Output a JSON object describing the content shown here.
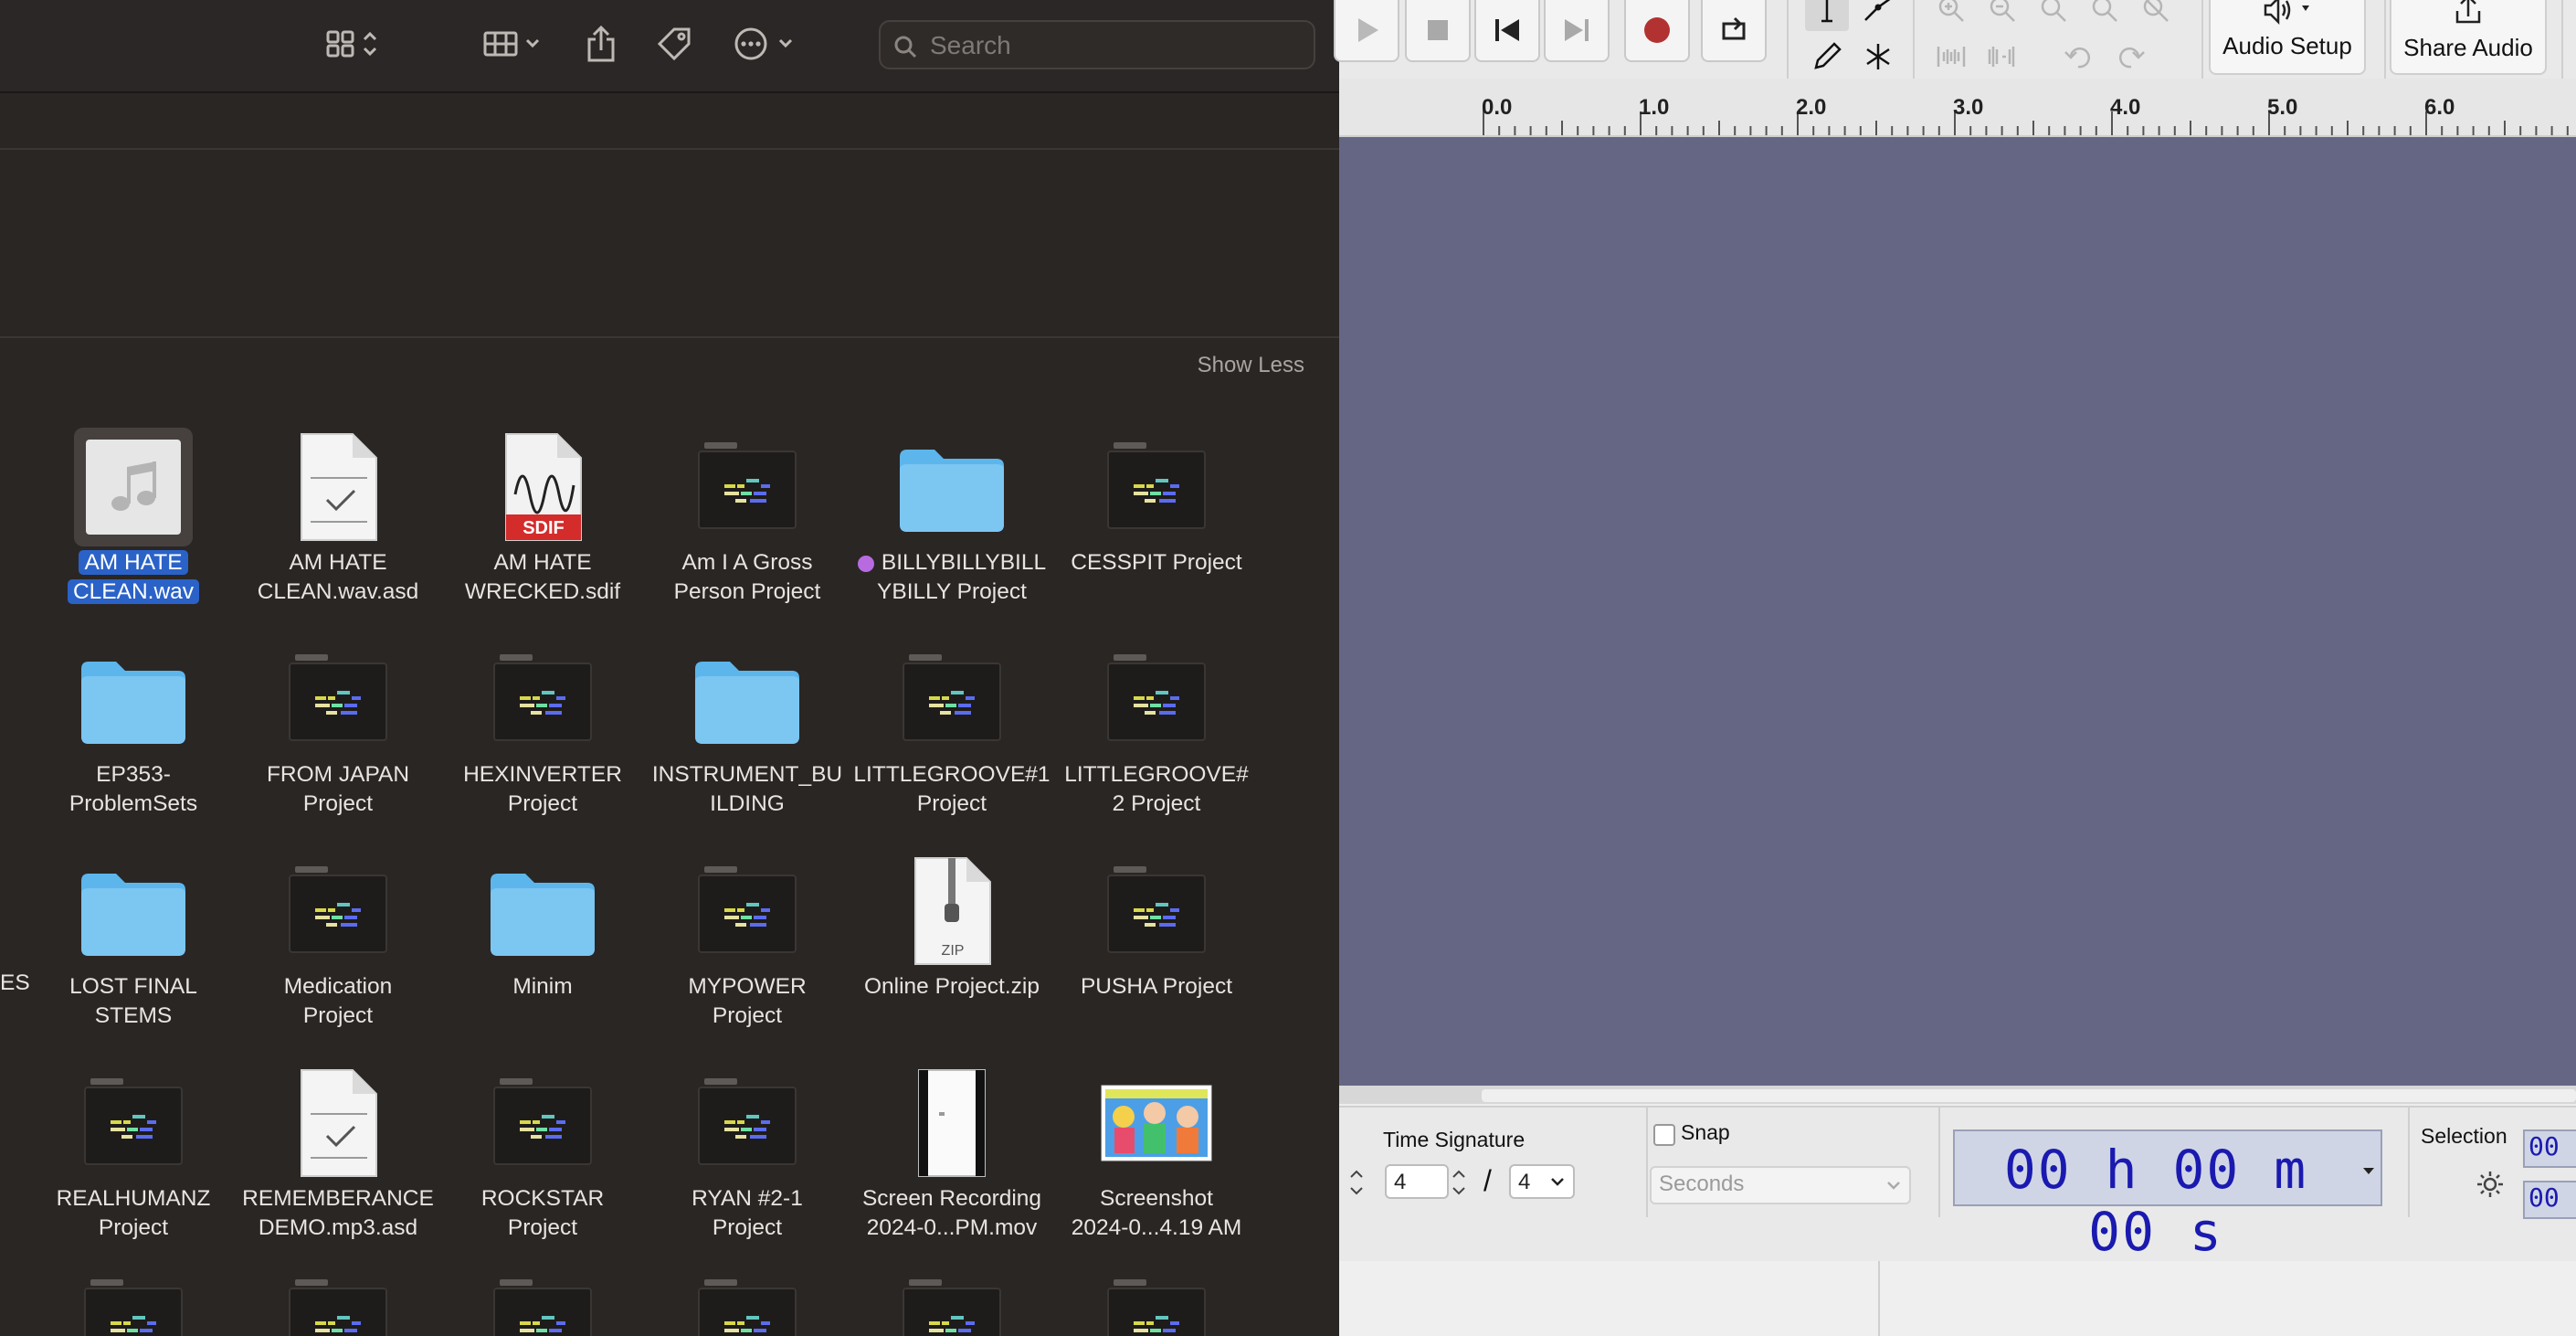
{
  "finder": {
    "search": {
      "placeholder": "Search",
      "value": ""
    },
    "show_less_label": "Show Less",
    "items": [
      {
        "name": "AM HATE\nCLEAN.wav",
        "kind": "audio-file",
        "selected": true
      },
      {
        "name": "AM HATE\nCLEAN.wav.asd",
        "kind": "generic-doc"
      },
      {
        "name": "AM HATE\nWRECKED.sdif",
        "kind": "sdif-file"
      },
      {
        "name": "Am I A Gross\nPerson Project",
        "kind": "ableton-project"
      },
      {
        "name": "BILLYBILLYBILL\nYBILLY Project",
        "kind": "folder",
        "tag": "purple"
      },
      {
        "name": "CESSPIT Project",
        "kind": "ableton-project"
      },
      {
        "name": "EP353-\nProblemSets",
        "kind": "folder"
      },
      {
        "name": "FROM JAPAN\nProject",
        "kind": "ableton-project"
      },
      {
        "name": "HEXINVERTER\nProject",
        "kind": "ableton-project"
      },
      {
        "name": "INSTRUMENT_BU\nILDING",
        "kind": "folder"
      },
      {
        "name": "LITTLEGROOVE#1\nProject",
        "kind": "ableton-project"
      },
      {
        "name": "LITTLEGROOVE#\n2 Project",
        "kind": "ableton-project"
      },
      {
        "name": "LOST FINAL\nSTEMS",
        "kind": "folder"
      },
      {
        "name": "Medication\nProject",
        "kind": "ableton-project"
      },
      {
        "name": "Minim",
        "kind": "folder"
      },
      {
        "name": "MYPOWER\nProject",
        "kind": "ableton-project"
      },
      {
        "name": "Online Project.zip",
        "kind": "zip-file"
      },
      {
        "name": "PUSHA Project",
        "kind": "ableton-project"
      },
      {
        "name": "REALHUMANZ\nProject",
        "kind": "ableton-project"
      },
      {
        "name": "REMEMBERANCE\nDEMO.mp3.asd",
        "kind": "generic-doc"
      },
      {
        "name": "ROCKSTAR\nProject",
        "kind": "ableton-project"
      },
      {
        "name": "RYAN #2-1\nProject",
        "kind": "ableton-project"
      },
      {
        "name": "Screen Recording\n2024-0...PM.mov",
        "kind": "movie-file"
      },
      {
        "name": "Screenshot\n2024-0...4.19 AM",
        "kind": "image-file"
      }
    ],
    "cut_off_label": "ES",
    "icon_text": {
      "sdif": "SDIF",
      "zip": "ZIP"
    },
    "colors": {
      "folder": "#5cb6ec",
      "tag_purple": "#b86be0",
      "selection": "#2a62c8"
    }
  },
  "audacity": {
    "audio_setup_label": "Audio Setup",
    "share_audio_label": "Share Audio",
    "ruler_ticks": [
      "0.0",
      "1.0",
      "2.0",
      "3.0",
      "4.0",
      "5.0",
      "6.0"
    ],
    "time_signature_label": "Time Signature",
    "time_sig_numerator": "4",
    "time_sig_denominator": "4",
    "time_sig_slash": "/",
    "snap_label": "Snap",
    "snap_units": "Seconds",
    "time_display": "00 h 00 m 00 s",
    "selection_label": "Selection",
    "selection_start": "00",
    "selection_end": "00",
    "colors": {
      "track_area": "#646684",
      "time_text": "#1a1ab0",
      "record": "#b23232"
    }
  }
}
